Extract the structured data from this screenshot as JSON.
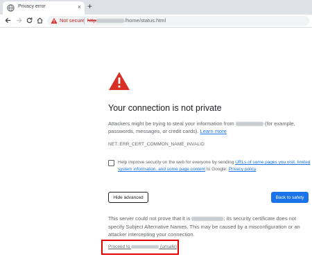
{
  "tab": {
    "title": "Privacy error",
    "close_glyph": "×",
    "favicon": "globe-icon"
  },
  "newtab": {
    "glyph": "+"
  },
  "toolbar": {
    "back_icon": "arrow-left-icon",
    "forward_icon": "arrow-right-icon",
    "reload_icon": "reload-icon",
    "home_icon": "home-icon"
  },
  "omnibox": {
    "security_label": "Not secure",
    "scheme": "https",
    "path": "/home/status.html"
  },
  "interstitial": {
    "heading": "Your connection is not private",
    "intro_before": "Attackers might be trying to steal your information from ",
    "intro_after": " (for example, passwords, messages, or credit cards). ",
    "learn_more": "Learn more",
    "error_code": "NET::ERR_CERT_COMMON_NAME_INVALID",
    "optin_before": "Help improve security on the web for everyone by sending ",
    "optin_link1": "URLs of some pages you visit, limited system information, and some page content",
    "optin_middle": " to Google. ",
    "optin_link2": "Privacy policy",
    "hide_advanced": "Hide advanced",
    "back_to_safety": "Back to safety",
    "details_before": "This server could not prove that it is ",
    "details_after": "; its security certificate does not specify Subject Alternative Names. This may be caused by a misconfiguration or an attacker intercepting your connection.",
    "proceed_before": "Proceed to ",
    "proceed_after": " (unsafe)"
  },
  "colors": {
    "accent": "#1a73e8",
    "warning_red": "#d93025",
    "highlight_box": "#e50000"
  }
}
